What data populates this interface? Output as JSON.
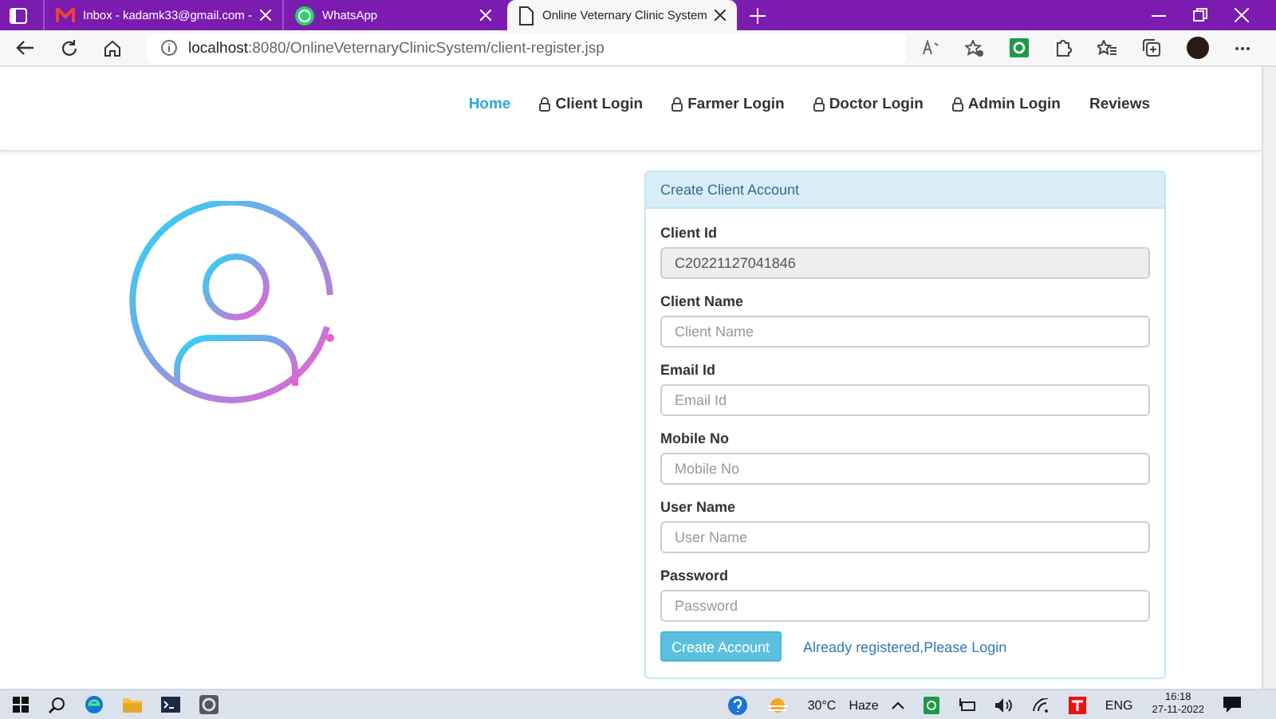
{
  "browser": {
    "tabs": [
      {
        "title": "Inbox - kadamk33@gmail.com -",
        "selected": false
      },
      {
        "title": "WhatsApp",
        "selected": false
      },
      {
        "title": "Online Veternary Clinic System",
        "selected": true
      }
    ],
    "url_host": "localhost",
    "url_path": ":8080/OnlineVeternaryClinicSystem/client-register.jsp"
  },
  "nav": {
    "items": [
      {
        "label": "Home",
        "lock": false,
        "selected": true
      },
      {
        "label": "Client Login",
        "lock": true,
        "selected": false
      },
      {
        "label": "Farmer Login",
        "lock": true,
        "selected": false
      },
      {
        "label": "Doctor Login",
        "lock": true,
        "selected": false
      },
      {
        "label": "Admin Login",
        "lock": true,
        "selected": false
      },
      {
        "label": "Reviews",
        "lock": false,
        "selected": false
      }
    ]
  },
  "form": {
    "title": "Create Client Account",
    "fields": [
      {
        "label": "Client Id",
        "value": "C20221127041846",
        "disabled": true
      },
      {
        "label": "Client Name",
        "placeholder": "Client Name",
        "disabled": false
      },
      {
        "label": "Email Id",
        "placeholder": "Email Id",
        "disabled": false
      },
      {
        "label": "Mobile No",
        "placeholder": "Mobile No",
        "disabled": false
      },
      {
        "label": "User Name",
        "placeholder": "User Name",
        "disabled": false
      },
      {
        "label": "Password",
        "placeholder": "Password",
        "disabled": false
      }
    ],
    "button": "Create Account",
    "link": "Already registered,Please Login"
  },
  "taskbar": {
    "temperature": "30°C",
    "weather": "Haze",
    "language": "ENG",
    "time": "16:18",
    "date": "27-11-2022"
  }
}
